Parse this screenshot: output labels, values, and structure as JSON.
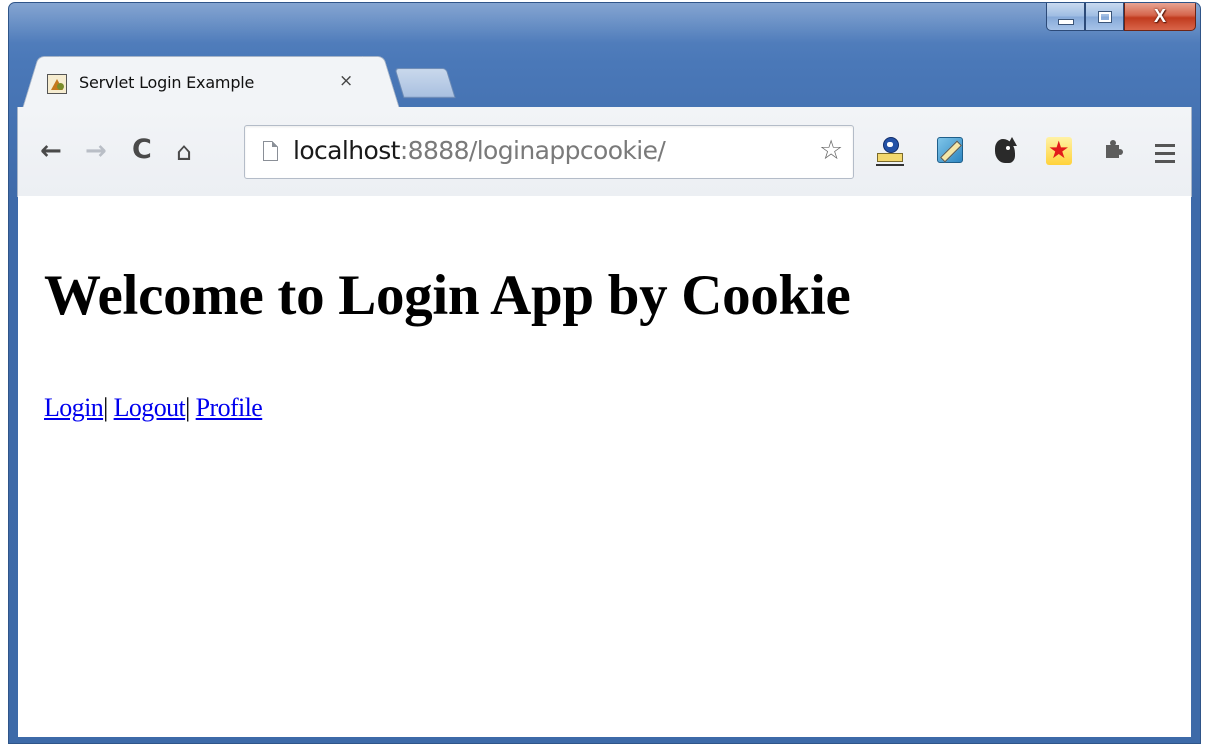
{
  "browser": {
    "tab": {
      "title": "Servlet Login Example",
      "close_symbol": "×",
      "favicon": "servlet-favicon"
    },
    "toolbar": {
      "back_symbol": "←",
      "forward_symbol": "→",
      "reload_symbol": "C",
      "home_symbol": "⌂",
      "url_host": "localhost",
      "url_rest": ":8888/loginappcookie/",
      "bookmark_symbol": "☆",
      "extensions": [
        "stamp-extension-icon",
        "pencil-extension-icon",
        "animal-extension-icon",
        "star-extension-icon",
        "puzzle-extension-icon"
      ]
    },
    "window_controls": {
      "close_label": "X"
    }
  },
  "page": {
    "heading": "Welcome to Login App by Cookie",
    "links": [
      {
        "label": "Login"
      },
      {
        "label": "Logout"
      },
      {
        "label": "Profile"
      }
    ],
    "separator": "|"
  },
  "colors": {
    "link": "#0000ee",
    "frame": "#4a78b8",
    "close_button": "#c13b1e"
  }
}
